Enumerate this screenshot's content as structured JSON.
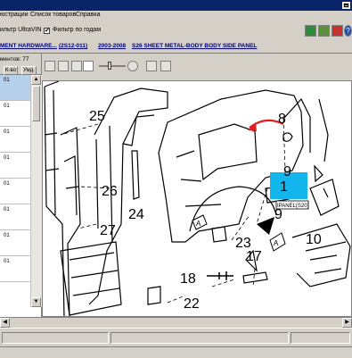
{
  "menu": {
    "item1": "юстрации",
    "item2": "Список товаров",
    "item3": "Справка"
  },
  "filters": {
    "ultravin_label": "ильтр UltraVIN",
    "year_filter_label": "Фильтр по годам",
    "year_filter_checked": "✔"
  },
  "breadcrumb": {
    "part1": "MENT HARDWARE...",
    "part2": "(2S12-011)",
    "part3": "2003-2008",
    "part4": "S26 SHEET METAL-BODY BODY SIDE PANEL"
  },
  "list": {
    "count_label": "ментов: 77",
    "col_qty": "К-во",
    "col_apply": "Умд.",
    "rows": [
      "01",
      "01",
      "01",
      "01",
      "01",
      "01",
      "01",
      "01"
    ]
  },
  "diagram": {
    "callouts": [
      "25",
      "8",
      "9",
      "1",
      "26",
      "24",
      "27",
      "23",
      "9",
      "10",
      "17",
      "18",
      "22"
    ],
    "inset_label": "IPANEL(S20)",
    "letter_labels": [
      "A",
      "A"
    ],
    "highlight_color": "#12b5ec",
    "pointer_color": "#e02020"
  }
}
